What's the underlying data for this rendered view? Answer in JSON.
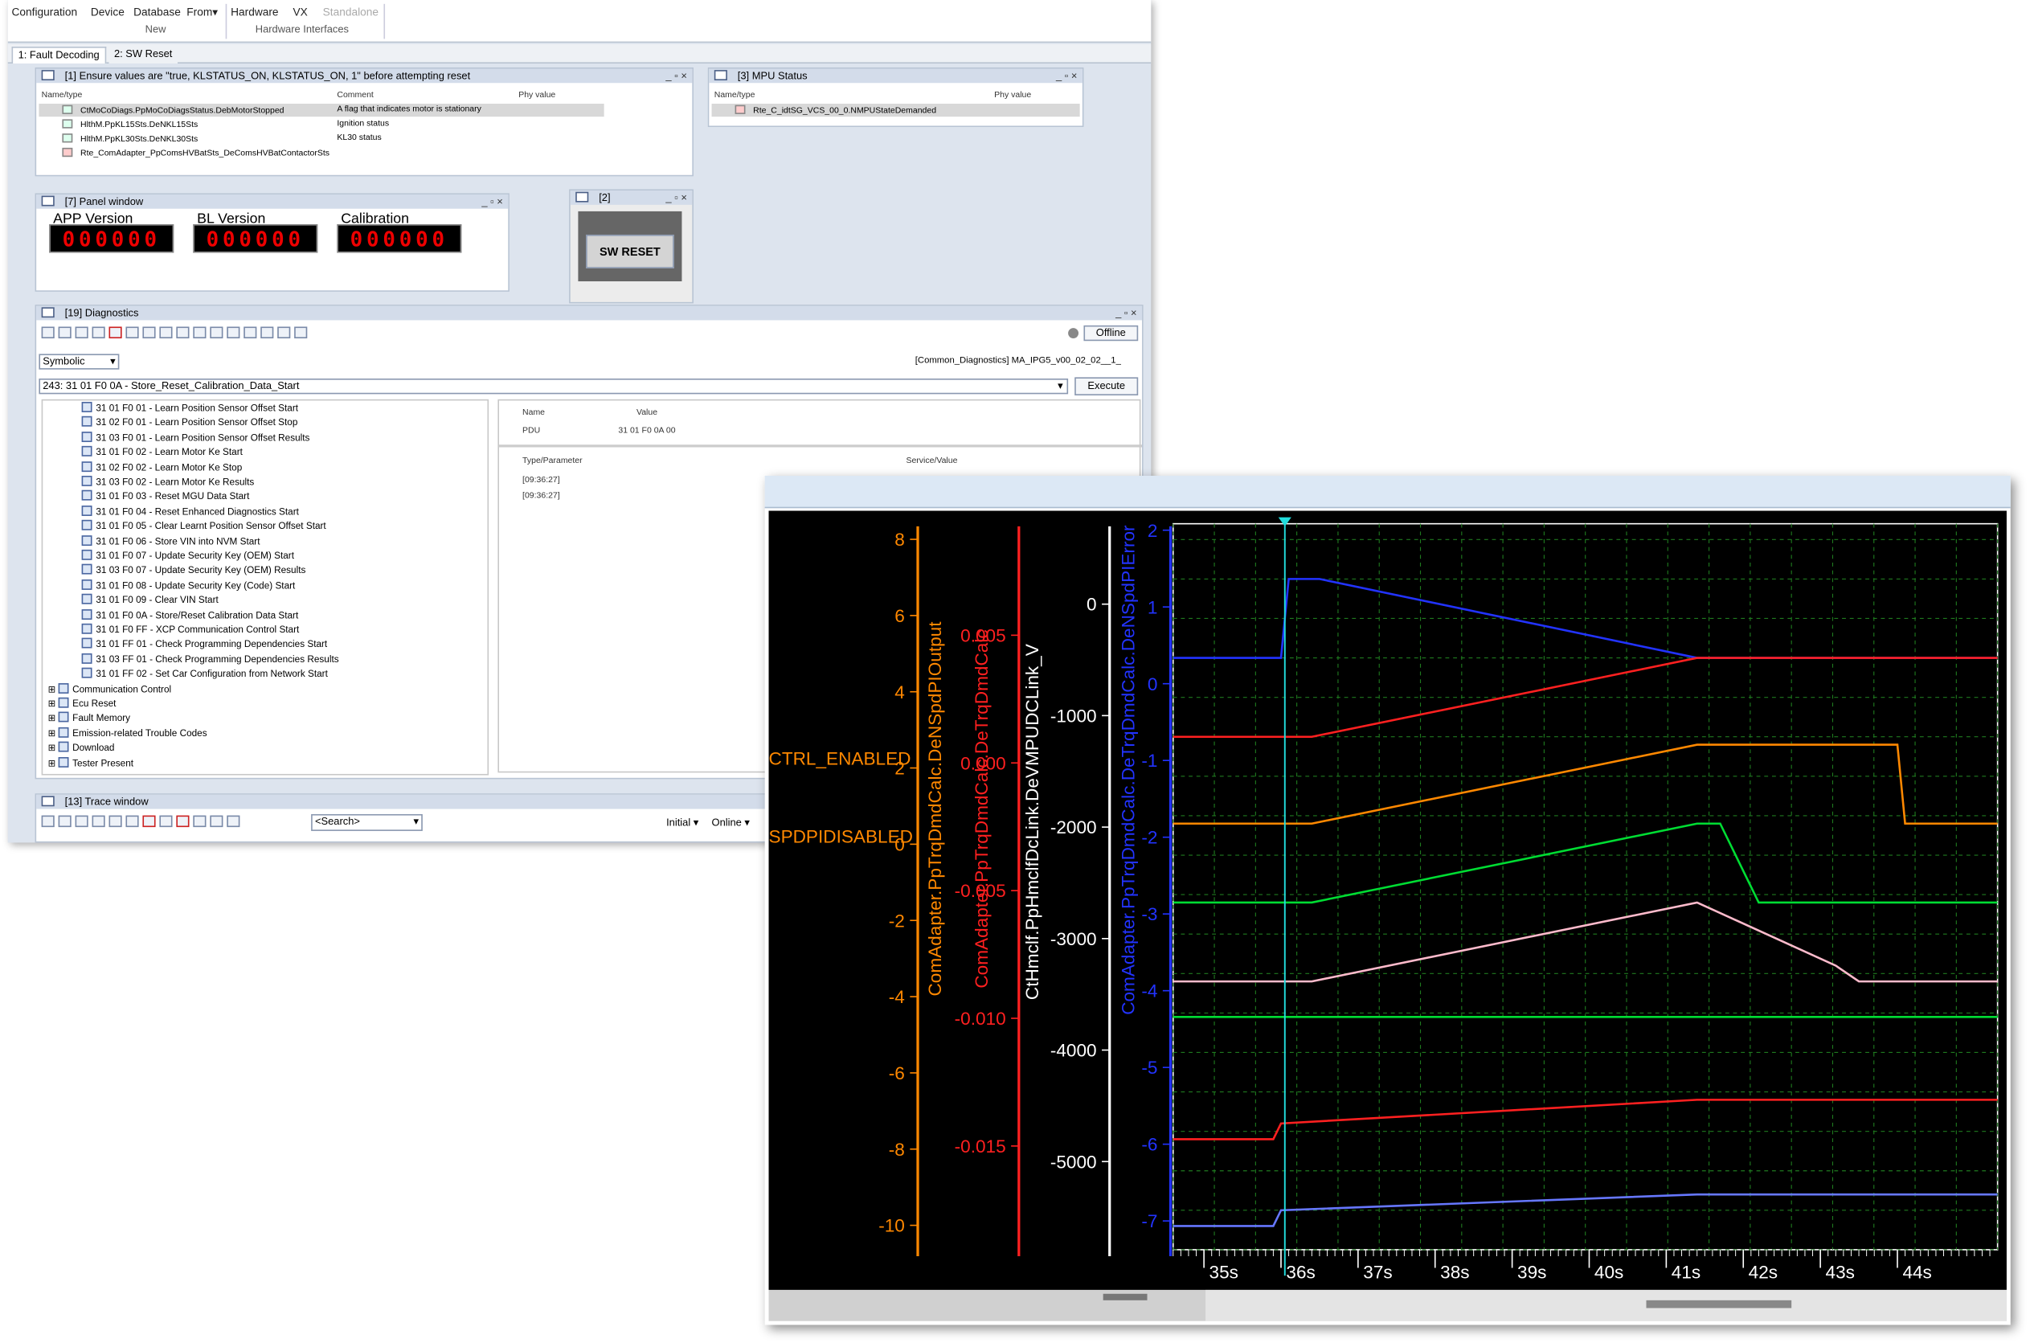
{
  "ribbon": {
    "items": [
      "Configuration",
      "Device",
      "Database",
      "From",
      "Hardware",
      "VX",
      "Standalone"
    ],
    "from_caret": "▾",
    "group_new": "New",
    "group_hw": "Hardware Interfaces"
  },
  "tabs": [
    "1: Fault Decoding",
    "2: SW Reset"
  ],
  "win1": {
    "title": "[1] Ensure values are \"true, KLSTATUS_ON, KLSTATUS_ON, 1\" before attempting reset",
    "cols": [
      "Name/type",
      "Comment",
      "Phy value"
    ],
    "rows": [
      {
        "name": "CtMoCoDiags.PpMoCoDiagsStatus.DebMotorStopped",
        "comment": "A flag that indicates motor is stationary"
      },
      {
        "name": "HlthM.PpKL15Sts.DeNKL15Sts",
        "comment": "Ignition status"
      },
      {
        "name": "HlthM.PpKL30Sts.DeNKL30Sts",
        "comment": "KL30 status"
      },
      {
        "name": "Rte_ComAdapter_PpComsHVBatSts_DeComsHVBatContactorSts",
        "comment": ""
      }
    ]
  },
  "win3": {
    "title": "[3] MPU Status",
    "cols": [
      "Name/type",
      "Phy value"
    ],
    "row": "Rte_C_idtSG_VCS_00_0.NMPUStateDemanded"
  },
  "panel": {
    "title": "[7] Panel window",
    "labels": [
      "APP Version",
      "BL Version",
      "Calibration"
    ],
    "digits": "000000"
  },
  "win2": {
    "title": "[2]",
    "button": "SW RESET"
  },
  "diag": {
    "title": "[19] Diagnostics",
    "offline": "Offline",
    "mode": "Symbolic",
    "path": "[Common_Diagnostics] MA_IPG5_v00_02_02__1_",
    "service": "243: 31 01 F0 0A - Store_Reset_Calibration_Data_Start",
    "execute": "Execute",
    "tree": [
      "31 01 F0 01 - Learn Position Sensor Offset Start",
      "31 02 F0 01 - Learn Position Sensor Offset Stop",
      "31 03 F0 01 - Learn Position Sensor Offset Results",
      "31 01 F0 02 - Learn Motor Ke Start",
      "31 02 F0 02 - Learn Motor Ke Stop",
      "31 03 F0 02 - Learn Motor Ke Results",
      "31 01 F0 03 - Reset MGU Data Start",
      "31 01 F0 04 - Reset Enhanced Diagnostics Start",
      "31 01 F0 05 - Clear Learnt Position Sensor Offset Start",
      "31 01 F0 06 - Store VIN into NVM Start",
      "31 01 F0 07 - Update Security Key (OEM) Start",
      "31 03 F0 07 - Update Security Key (OEM) Results",
      "31 01 F0 08 - Update Security Key (Code) Start",
      "31 01 F0 09 - Clear VIN Start",
      "31 01 F0 0A - Store/Reset Calibration Data Start",
      "31 01 F0 FF - XCP Communication Control Start",
      "31 01 FF 01 - Check Programming Dependencies Start",
      "31 03 FF 01 - Check Programming Dependencies Results",
      "31 01 FF 02 - Set Car Configuration from Network Start"
    ],
    "groups": [
      "Communication Control",
      "Ecu Reset",
      "Fault Memory",
      "Emission-related Trouble Codes",
      "Download",
      "Tester Present"
    ],
    "name_col": "Name",
    "value_col": "Value",
    "pdu_label": "PDU",
    "pdu_value": "31 01 F0 0A 00",
    "type_col": "Type/Parameter",
    "sv_col": "Service/Value",
    "log": [
      "[09:36:27]",
      "[09:36:27]"
    ]
  },
  "trace": {
    "title": "[13] Trace window",
    "search": "<Search>",
    "initial": "Initial",
    "online": "Online"
  },
  "chart_data": {
    "type": "line",
    "x_ticks": [
      "35s",
      "36s",
      "37s",
      "38s",
      "39s",
      "40s",
      "41s",
      "42s",
      "43s",
      "44s"
    ],
    "xlim": [
      34.6,
      45.3
    ],
    "axes": [
      {
        "label": "ComAdapter.PpTrqDmdCalc.DeNSpdPIOutput",
        "color": "#ff8800",
        "ticks": [
          "8",
          "6",
          "4",
          "2",
          "0",
          "-2",
          "-4",
          "-6",
          "-8",
          "-10"
        ]
      },
      {
        "label": "ComAdapter.PpTrqDmdCalc.DeTrqDmdCalc",
        "color": "#ff2020",
        "ticks": [
          "0.005",
          "0.000",
          "-0.005",
          "-0.010",
          "-0.015"
        ]
      },
      {
        "label": "CtHmclf.PpHmclfDcLink.DeVMPUDCLink_V",
        "color": "#ffffff",
        "ticks": [
          "0",
          "-1000",
          "-2000",
          "-3000",
          "-4000",
          "-5000"
        ]
      },
      {
        "label": "ComAdapter.PpTrqDmdCalc.DeTrqDmdCalc.DeNSpdPIError",
        "color": "#2233ff",
        "ticks": [
          "2",
          "1",
          "0",
          "-1",
          "-2",
          "-3",
          "-4",
          "-5",
          "-6",
          "-7"
        ]
      }
    ],
    "state_labels": [
      "CTRL_ENABLED",
      "SPDPIDISABLED"
    ],
    "series": [
      {
        "color": "#2233ff",
        "x": [
          34.6,
          36.0,
          36.1,
          36.5,
          41.4,
          45.3
        ],
        "y": [
          0,
          0,
          1,
          1,
          0,
          0
        ]
      },
      {
        "color": "#ff2020",
        "x": [
          34.6,
          36.4,
          41.4,
          45.3
        ],
        "y": [
          -1,
          -1,
          0,
          0
        ]
      },
      {
        "color": "#ff8800",
        "x": [
          34.6,
          36.4,
          41.4,
          44.0,
          44.1,
          45.3
        ],
        "y": [
          -2.1,
          -2.1,
          -1.1,
          -1.1,
          -2.1,
          -2.1
        ]
      },
      {
        "color": "#00dd33",
        "x": [
          34.6,
          36.4,
          41.4,
          41.7,
          42.2,
          45.3
        ],
        "y": [
          -3.1,
          -3.1,
          -2.1,
          -2.1,
          -3.1,
          -3.1
        ]
      },
      {
        "color": "#ffbbcc",
        "x": [
          34.6,
          36.4,
          41.4,
          43.2,
          43.5,
          43.7,
          45.3
        ],
        "y": [
          -4.1,
          -4.1,
          -3.1,
          -3.9,
          -4.1,
          -4.1,
          -4.1
        ]
      },
      {
        "color": "#00dd33",
        "x": [
          34.6,
          45.3
        ],
        "y": [
          -4.55,
          -4.55
        ]
      },
      {
        "color": "#ff2020",
        "x": [
          34.6,
          35.9,
          36.0,
          41.4,
          45.3
        ],
        "y": [
          -6.1,
          -6.1,
          -5.9,
          -5.6,
          -5.6
        ]
      },
      {
        "color": "#6677ff",
        "x": [
          34.6,
          35.9,
          36.0,
          41.4,
          45.3
        ],
        "y": [
          -7.2,
          -7.2,
          -7.0,
          -6.8,
          -6.8
        ]
      }
    ],
    "cursor_x": 36.05,
    "grid": true
  }
}
